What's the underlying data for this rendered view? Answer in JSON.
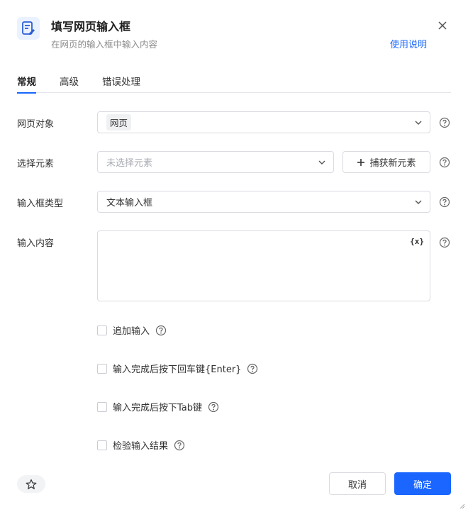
{
  "header": {
    "icon": "edit-document-icon",
    "title": "填写网页输入框",
    "subtitle": "在网页的输入框中输入内容",
    "help_link": "使用说明",
    "close_icon": "close-icon"
  },
  "tabs": [
    {
      "label": "常规",
      "active": true
    },
    {
      "label": "高级",
      "active": false
    },
    {
      "label": "错误处理",
      "active": false
    }
  ],
  "form": {
    "web_object": {
      "label": "网页对象",
      "value": "网页"
    },
    "select_element": {
      "label": "选择元素",
      "placeholder": "未选择元素",
      "capture_label": "捕获新元素"
    },
    "input_type": {
      "label": "输入框类型",
      "value": "文本输入框"
    },
    "input_content": {
      "label": "输入内容",
      "value": "",
      "variable_button": "{x}"
    }
  },
  "options": [
    {
      "label": "追加输入",
      "checked": false
    },
    {
      "label": "输入完成后按下回车键{Enter}",
      "checked": false
    },
    {
      "label": "输入完成后按下Tab键",
      "checked": false
    },
    {
      "label": "检验输入结果",
      "checked": false
    }
  ],
  "footer": {
    "favorite_icon": "star-icon",
    "cancel_label": "取消",
    "ok_label": "确定"
  },
  "colors": {
    "primary": "#1a66ff",
    "border": "#d9dbe0",
    "text": "#333333",
    "muted": "#8c8c8c"
  }
}
